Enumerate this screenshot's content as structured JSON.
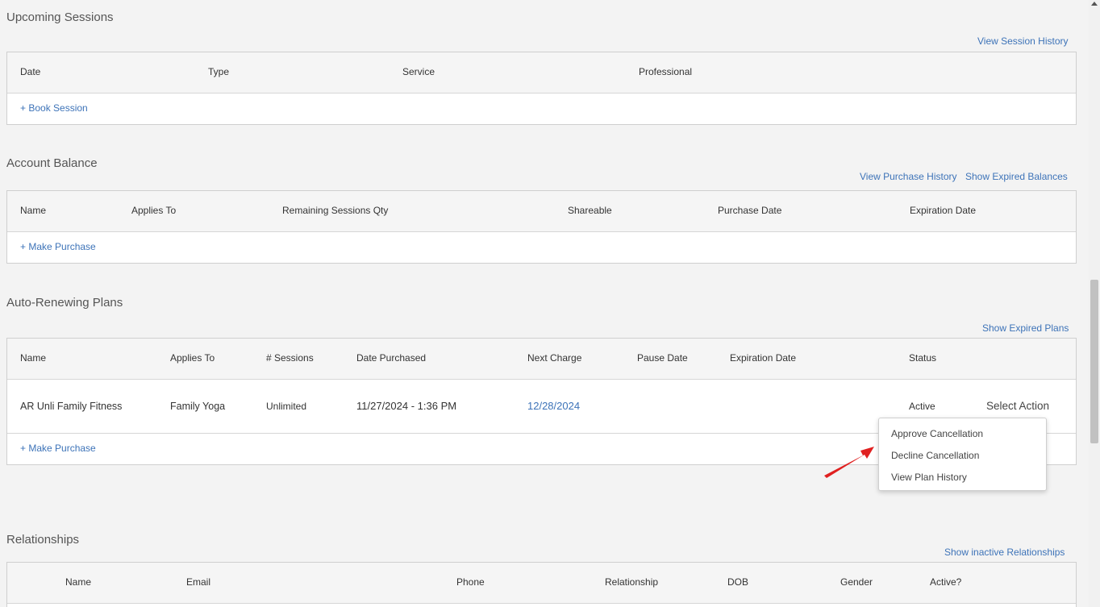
{
  "upcoming": {
    "title": "Upcoming Sessions",
    "history_link": "View Session History",
    "columns": [
      "Date",
      "Type",
      "Service",
      "Professional"
    ],
    "add_link": "+ Book Session"
  },
  "balance": {
    "title": "Account Balance",
    "purchase_history_link": "View Purchase History",
    "expired_link": "Show Expired Balances",
    "columns": [
      "Name",
      "Applies To",
      "Remaining Sessions Qty",
      "Shareable",
      "Purchase Date",
      "Expiration Date"
    ],
    "add_link": "+ Make Purchase"
  },
  "plans": {
    "title": "Auto-Renewing Plans",
    "expired_link": "Show Expired Plans",
    "columns": [
      "Name",
      "Applies To",
      "# Sessions",
      "Date Purchased",
      "Next Charge",
      "Pause Date",
      "Expiration Date",
      "Status"
    ],
    "row": {
      "name": "AR Unli Family Fitness",
      "applies_to": "Family Yoga",
      "sessions": "Unlimited",
      "date_purchased": "11/27/2024 - 1:36 PM",
      "next_charge": "12/28/2024",
      "status": "Active",
      "action": "Select Action"
    },
    "add_link": "+ Make Purchase",
    "dropdown": [
      "Approve Cancellation",
      "Decline Cancellation",
      "View Plan History"
    ]
  },
  "relationships": {
    "title": "Relationships",
    "inactive_link": "Show inactive Relationships",
    "columns": [
      "Name",
      "Email",
      "Phone",
      "Relationship",
      "DOB",
      "Gender",
      "Active?"
    ]
  },
  "colors": {
    "link": "#3d73b8",
    "arrow": "#e02020"
  }
}
